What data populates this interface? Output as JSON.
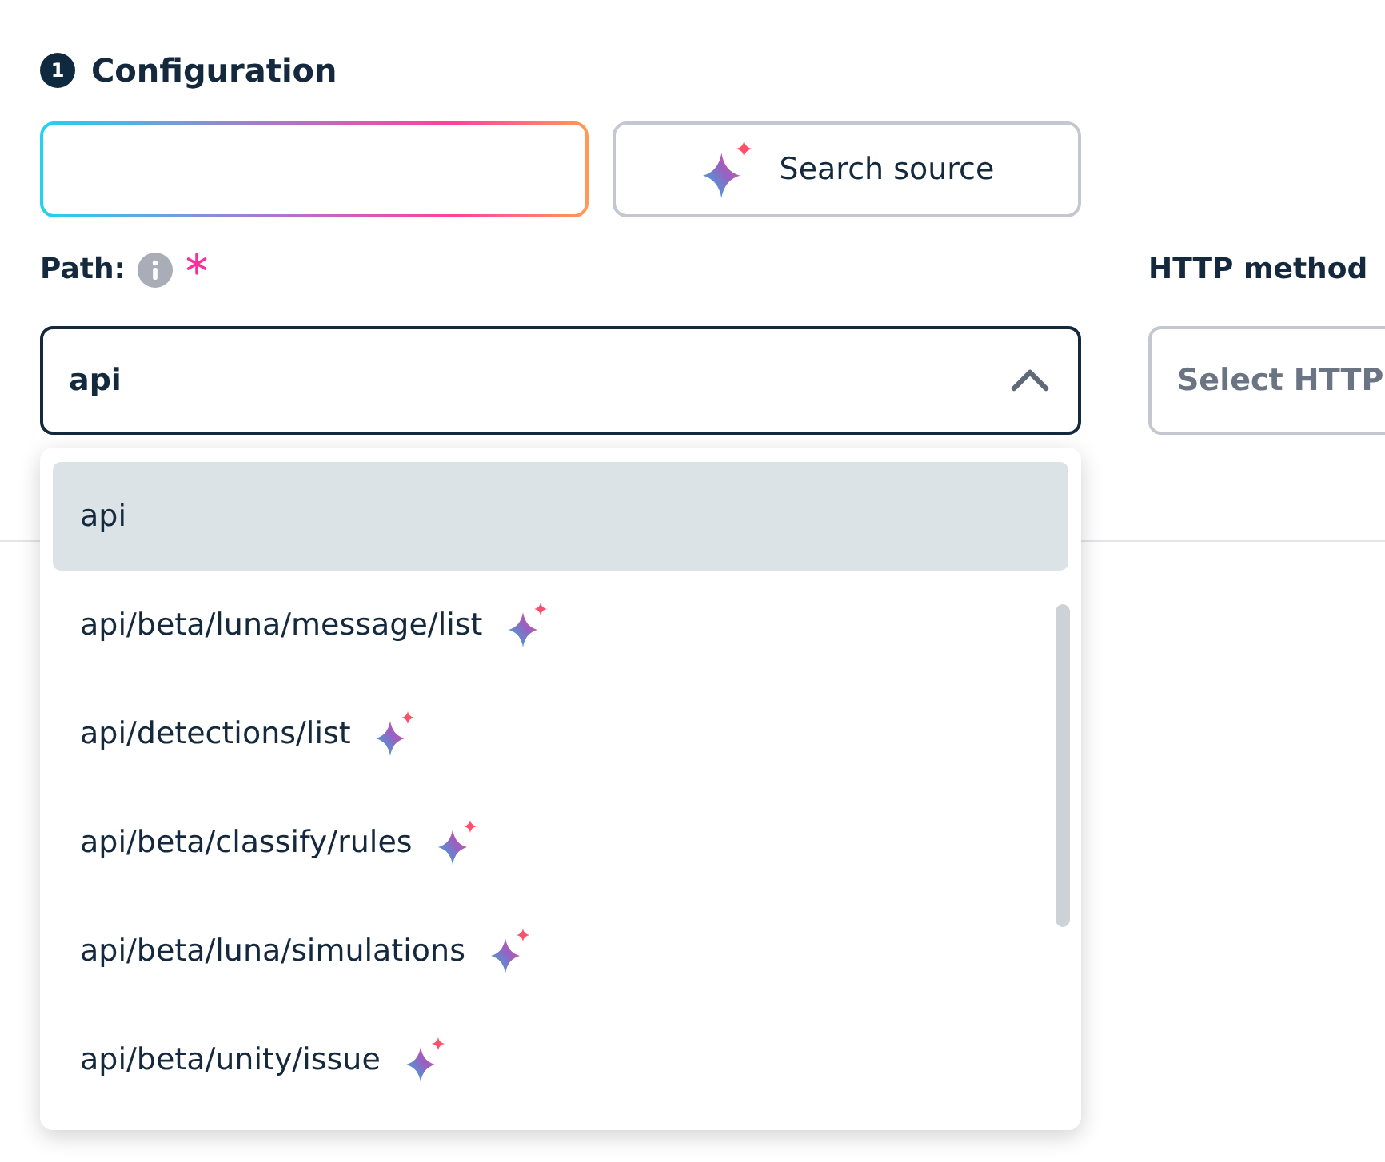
{
  "section": {
    "step": "1",
    "title": "Configuration"
  },
  "search_button": {
    "label": "Search source"
  },
  "path": {
    "label": "Path:",
    "required": true,
    "value": "api",
    "expanded": true
  },
  "http_methods": {
    "label": "HTTP method",
    "placeholder": "Select HTTP"
  },
  "path_options": [
    {
      "label": "api",
      "selected": true,
      "suggested": false
    },
    {
      "label": "api/beta/luna/message/list",
      "selected": false,
      "suggested": true
    },
    {
      "label": "api/detections/list",
      "selected": false,
      "suggested": true
    },
    {
      "label": "api/beta/classify/rules",
      "selected": false,
      "suggested": true
    },
    {
      "label": "api/beta/luna/simulations",
      "selected": false,
      "suggested": true
    },
    {
      "label": "api/beta/unity/issue",
      "selected": false,
      "suggested": true
    }
  ]
}
